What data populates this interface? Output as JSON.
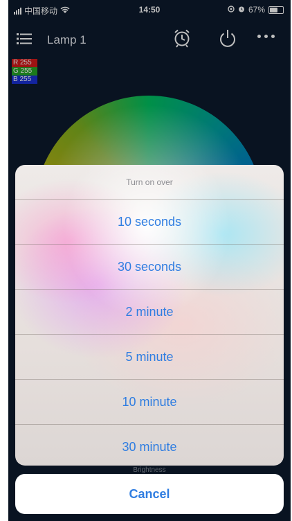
{
  "status_bar": {
    "carrier": "中国移动",
    "time": "14:50",
    "battery": "67%",
    "battery_level": 0.67
  },
  "nav": {
    "title": "Lamp 1"
  },
  "rgb_readout": {
    "r": "R 255",
    "g": "G 255",
    "b": "B 255"
  },
  "action_sheet": {
    "title": "Turn on over",
    "options": [
      "10 seconds",
      "30 seconds",
      "2 minute",
      "5 minute",
      "10 minute",
      "30 minute"
    ],
    "cancel_label": "Cancel"
  },
  "background": {
    "brightness_label": "Brightness"
  },
  "colors": {
    "accent": "#2f7de1",
    "app_background": "#0d1a2c"
  }
}
